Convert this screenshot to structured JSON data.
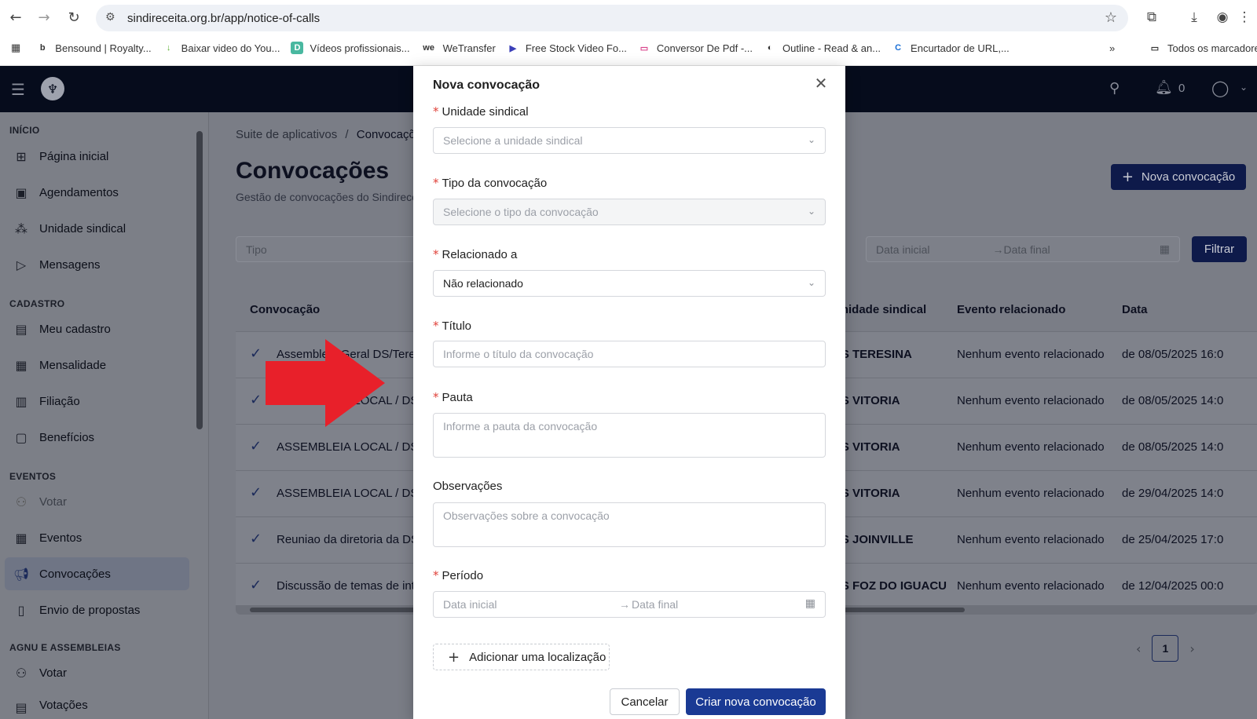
{
  "browser": {
    "url": "sindireceita.org.br/app/notice-of-calls",
    "bookmarks": [
      {
        "label": "Bensound | Royalty...",
        "icon": "b"
      },
      {
        "label": "Baixar video do You...",
        "icon": "↓"
      },
      {
        "label": "Vídeos profissionais...",
        "icon": "D"
      },
      {
        "label": "WeTransfer",
        "icon": "we"
      },
      {
        "label": "Free Stock Video Fo...",
        "icon": "▶"
      },
      {
        "label": "Conversor De Pdf -...",
        "icon": "▭"
      },
      {
        "label": "Outline - Read & an...",
        "icon": "◐"
      },
      {
        "label": "Encurtador de URL,...",
        "icon": "C"
      }
    ],
    "all_bookmarks_label": "Todos os marcadores"
  },
  "topbar": {
    "notifications_count": "0"
  },
  "sidebar": {
    "sections": [
      {
        "title": "INÍCIO",
        "items": [
          "Página inicial",
          "Agendamentos",
          "Unidade sindical",
          "Mensagens"
        ]
      },
      {
        "title": "CADASTRO",
        "items": [
          "Meu cadastro",
          "Mensalidade",
          "Filiação",
          "Benefícios"
        ]
      },
      {
        "title": "EVENTOS",
        "items": [
          "Votar",
          "Eventos",
          "Convocações",
          "Envio de propostas"
        ]
      },
      {
        "title": "AGNU E ASSEMBLEIAS",
        "items": [
          "Votar",
          "Votações"
        ]
      }
    ]
  },
  "page": {
    "breadcrumb_root": "Suite de aplicativos",
    "breadcrumb_sep": "/",
    "breadcrumb_current": "Convocações",
    "title": "Convocações",
    "subtitle": "Gestão de convocações do Sindireceita",
    "new_button": "Nova convocação",
    "filter_type_placeholder": "Tipo",
    "filter_start": "Data inicial",
    "filter_end": "Data final",
    "filter_button": "Filtrar",
    "pagination_current": "1"
  },
  "table": {
    "headers": {
      "call": "Convocação",
      "unit": "Unidade sindical",
      "event": "Evento relacionado",
      "date": "Data"
    },
    "rows": [
      {
        "call": "Assembleia Geral DS/Teresina",
        "unit": "DS TERESINA",
        "event": "Nenhum evento relacionado",
        "date": "de 08/05/2025 16:0"
      },
      {
        "call": "ASSEMBLEIA LOCAL / DS VITORIA",
        "unit": "DS VITORIA",
        "event": "Nenhum evento relacionado",
        "date": "de 08/05/2025 14:0"
      },
      {
        "call": "ASSEMBLEIA LOCAL / DS VITORIA",
        "unit": "DS VITORIA",
        "event": "Nenhum evento relacionado",
        "date": "de 08/05/2025 14:0"
      },
      {
        "call": "ASSEMBLEIA LOCAL / DS VITORIA",
        "unit": "DS VITORIA",
        "event": "Nenhum evento relacionado",
        "date": "de 29/04/2025 14:0"
      },
      {
        "call": "Reuniao da diretoria da DS Joinville",
        "unit": "DS JOINVILLE",
        "event": "Nenhum evento relacionado",
        "date": "de 25/04/2025 17:0"
      },
      {
        "call": "Discussão de temas de interesse",
        "unit": "DS FOZ DO IGUACU",
        "event": "Nenhum evento relacionado",
        "date": "de 12/04/2025 00:0"
      }
    ]
  },
  "modal": {
    "title": "Nova convocação",
    "unidade_label": "Unidade sindical",
    "unidade_placeholder": "Selecione a unidade sindical",
    "tipo_label": "Tipo da convocação",
    "tipo_placeholder": "Selecione o tipo da convocação",
    "relacionado_label": "Relacionado a",
    "relacionado_value": "Não relacionado",
    "titulo_label": "Título",
    "titulo_placeholder": "Informe o título da convocação",
    "pauta_label": "Pauta",
    "pauta_placeholder": "Informe a pauta da convocação",
    "obs_label": "Observações",
    "obs_placeholder": "Observações sobre a convocação",
    "periodo_label": "Período",
    "periodo_start": "Data inicial",
    "periodo_sep": "→",
    "periodo_end": "Data final",
    "add_location": "Adicionar uma localização",
    "cancel": "Cancelar",
    "create": "Criar nova convocação"
  },
  "colors": {
    "primary": "#1a3a94",
    "required": "#e0423a",
    "arrow": "#e8202a",
    "topbar": "#060c1c"
  }
}
